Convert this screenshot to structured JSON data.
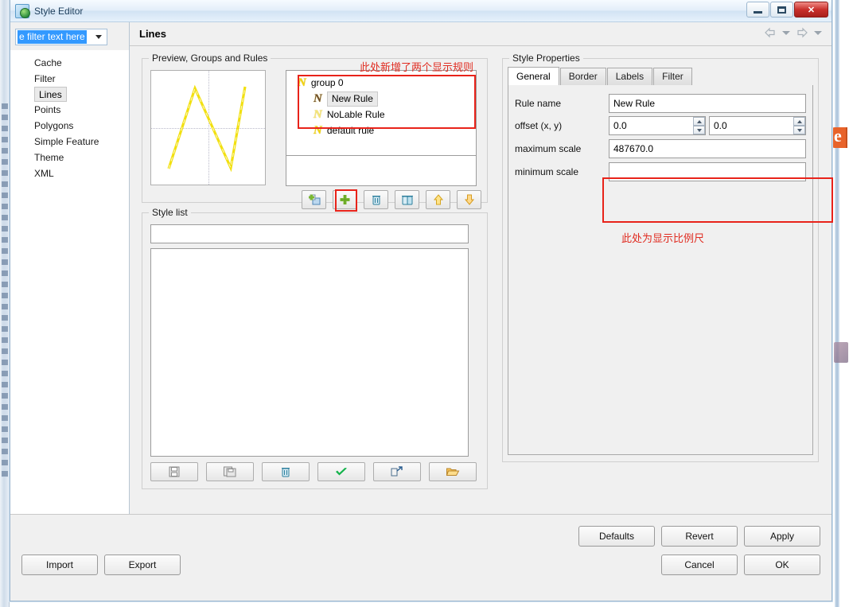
{
  "window": {
    "title": "Style Editor",
    "app_icon": "style-editor-icon",
    "buttons": {
      "minimize": "minimize-icon",
      "maximize": "maximize-icon",
      "close": "close-icon"
    }
  },
  "sidebar": {
    "filter": {
      "value": "e filter text here",
      "placeholder": "type filter text here",
      "dropdown_icon": "chevron-down-icon"
    },
    "items": [
      {
        "label": "Cache",
        "selected": false
      },
      {
        "label": "Filter",
        "selected": false
      },
      {
        "label": "Lines",
        "selected": true
      },
      {
        "label": "Points",
        "selected": false
      },
      {
        "label": "Polygons",
        "selected": false
      },
      {
        "label": "Simple Feature",
        "selected": false
      },
      {
        "label": "Theme",
        "selected": false
      },
      {
        "label": "XML",
        "selected": false
      }
    ]
  },
  "pane": {
    "title": "Lines",
    "nav": {
      "back": "back-arrow-icon",
      "back_menu": "chevron-down-icon",
      "forward": "forward-arrow-icon",
      "forward_menu": "chevron-down-icon"
    }
  },
  "preview_group": {
    "legend": "Preview, Groups and Rules",
    "preview_stroke_color": "#f2e010",
    "rules": [
      {
        "label": "group 0",
        "level": 0,
        "icon": "rule-group-icon",
        "selected": false,
        "icon_tone": "bright"
      },
      {
        "label": "New Rule",
        "level": 1,
        "icon": "rule-icon",
        "selected": true,
        "icon_tone": "dark"
      },
      {
        "label": "NoLable Rule",
        "level": 1,
        "icon": "rule-icon",
        "selected": false,
        "icon_tone": "pale"
      },
      {
        "label": "default rule",
        "level": 1,
        "icon": "rule-icon",
        "selected": false,
        "icon_tone": "bright"
      }
    ],
    "toolbar": [
      {
        "name": "add-group-button",
        "icon": "add-group-icon"
      },
      {
        "name": "add-rule-button",
        "icon": "add-rule-icon",
        "highlighted": true
      },
      {
        "name": "delete-rule-button",
        "icon": "trash-icon"
      },
      {
        "name": "delete-group-button",
        "icon": "trash-multiple-icon"
      },
      {
        "name": "move-up-button",
        "icon": "arrow-up-icon"
      },
      {
        "name": "move-down-button",
        "icon": "arrow-down-icon"
      }
    ]
  },
  "style_list": {
    "legend": "Style list",
    "input_value": "",
    "items": [],
    "toolbar": [
      {
        "name": "save-style-button",
        "icon": "save-icon"
      },
      {
        "name": "save-as-style-button",
        "icon": "save-copy-icon"
      },
      {
        "name": "delete-style-button",
        "icon": "trash-icon"
      },
      {
        "name": "validate-style-button",
        "icon": "check-icon"
      },
      {
        "name": "export-style-button",
        "icon": "export-icon"
      },
      {
        "name": "open-style-button",
        "icon": "folder-open-icon"
      }
    ]
  },
  "style_properties": {
    "legend": "Style Properties",
    "tabs": [
      {
        "label": "General",
        "active": true
      },
      {
        "label": "Border",
        "active": false
      },
      {
        "label": "Labels",
        "active": false
      },
      {
        "label": "Filter",
        "active": false
      }
    ],
    "fields": {
      "rule_name": {
        "label": "Rule name",
        "value": "New Rule"
      },
      "offset": {
        "label": "offset (x, y)",
        "x_value": "0.0",
        "y_value": "0.0"
      },
      "maximum_scale": {
        "label": "maximum scale",
        "value": "487670.0"
      },
      "minimum_scale": {
        "label": "minimum scale",
        "value": ""
      }
    }
  },
  "annotations": [
    {
      "text": "此处新增了两个显示规则",
      "color": "#e02b20"
    },
    {
      "text": "此处为显示比例尺",
      "color": "#e02b20"
    }
  ],
  "footer": {
    "defaults": "Defaults",
    "revert": "Revert",
    "apply": "Apply",
    "cancel": "Cancel",
    "ok": "OK",
    "import": "Import",
    "export": "Export"
  }
}
